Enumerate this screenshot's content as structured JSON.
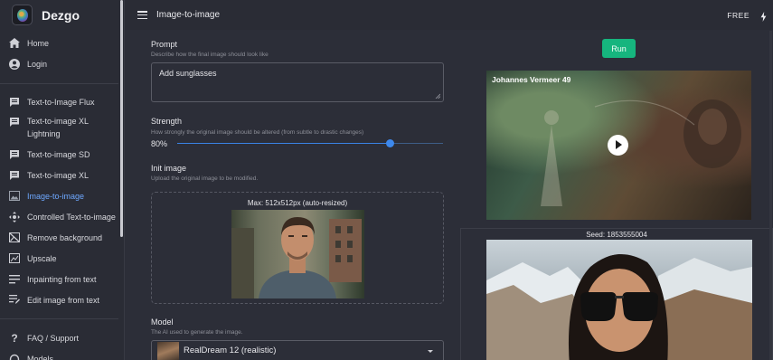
{
  "app": {
    "name": "Dezgo"
  },
  "header": {
    "title": "Image-to-image",
    "plan": "FREE",
    "menu_icon": "hamburger-menu-icon",
    "bolt_icon": "bolt-icon"
  },
  "sidebar": {
    "top": [
      {
        "label": "Home",
        "icon": "home-icon"
      },
      {
        "label": "Login",
        "icon": "account-icon"
      }
    ],
    "tools": [
      {
        "label": "Text-to-Image Flux",
        "icon": "message-icon"
      },
      {
        "label": "Text-to-image XL Lightning",
        "icon": "message-icon"
      },
      {
        "label": "Text-to-image SD",
        "icon": "message-icon"
      },
      {
        "label": "Text-to-image XL",
        "icon": "message-icon"
      },
      {
        "label": "Image-to-image",
        "icon": "image-icon",
        "active": true
      },
      {
        "label": "Controlled Text-to-image",
        "icon": "control-icon"
      },
      {
        "label": "Remove background",
        "icon": "remove-background-icon"
      },
      {
        "label": "Upscale",
        "icon": "upscale-icon"
      },
      {
        "label": "Inpainting from text",
        "icon": "inpainting-icon"
      },
      {
        "label": "Edit image from text",
        "icon": "edit-text-icon"
      }
    ],
    "bottom": [
      {
        "label": "FAQ / Support",
        "icon": "help-icon"
      },
      {
        "label": "Models",
        "icon": "models-icon"
      }
    ]
  },
  "form": {
    "prompt": {
      "title": "Prompt",
      "help": "Describe how the final image should look like",
      "value": "Add sunglasses"
    },
    "strength": {
      "title": "Strength",
      "help": "How strongly the original image should be altered (from subtle to drastic changes)",
      "value_label": "80%",
      "value": 0.8
    },
    "init_image": {
      "title": "Init image",
      "help": "Upload the original image to be modified.",
      "max_label": "Max: 512x512px (auto-resized)"
    },
    "model": {
      "title": "Model",
      "help": "The AI used to generate the image.",
      "value": "RealDream 12 (realistic)"
    }
  },
  "actions": {
    "run_label": "Run"
  },
  "video": {
    "title": "Johannes Vermeer 49"
  },
  "result": {
    "seed_label": "Seed: 1853555004"
  },
  "colors": {
    "accent": "#16b57e",
    "active_nav": "#6ea8ff",
    "slider": "#3a82e4",
    "background": "#2c2e38"
  }
}
